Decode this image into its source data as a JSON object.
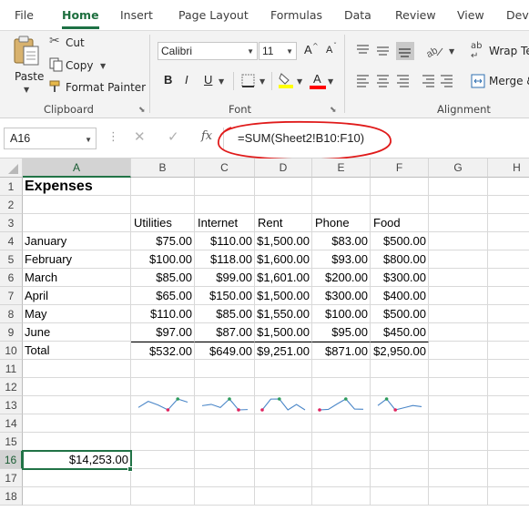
{
  "ribbon_tabs": [
    "File",
    "Home",
    "Insert",
    "Page Layout",
    "Formulas",
    "Data",
    "Review",
    "View",
    "Dev"
  ],
  "active_tab": "Home",
  "clipboard": {
    "paste": "Paste",
    "cut": "Cut",
    "copy": "Copy",
    "format_painter": "Format Painter",
    "group": "Clipboard"
  },
  "font": {
    "name": "Calibri",
    "size": "11",
    "grow": "A",
    "shrink": "A",
    "bold": "B",
    "italic": "I",
    "underline": "U",
    "font_color": "A",
    "highlight_color": "#ffff00",
    "text_color": "#ff0000",
    "group": "Font"
  },
  "alignment": {
    "wrap_text": "Wrap Te",
    "merge": "Merge &",
    "group": "Alignment"
  },
  "formula_bar": {
    "name_box": "A16",
    "fx": "fx",
    "formula": "=SUM(Sheet2!B10:F10)"
  },
  "columns": [
    "A",
    "B",
    "C",
    "D",
    "E",
    "F",
    "G",
    "H"
  ],
  "rows": [
    "1",
    "2",
    "3",
    "4",
    "5",
    "6",
    "7",
    "8",
    "9",
    "10",
    "11",
    "12",
    "13",
    "14",
    "15",
    "16",
    "17",
    "18"
  ],
  "selected_cell": "A16",
  "sheet": {
    "title": "Expenses",
    "headers": [
      "Utilities",
      "Internet",
      "Rent",
      "Phone",
      "Food"
    ],
    "data_rows": [
      {
        "month": "January",
        "values": [
          "$75.00",
          "$110.00",
          "$1,500.00",
          "$83.00",
          "$500.00"
        ]
      },
      {
        "month": "February",
        "values": [
          "$100.00",
          "$118.00",
          "$1,600.00",
          "$93.00",
          "$800.00"
        ]
      },
      {
        "month": "March",
        "values": [
          "$85.00",
          "$99.00",
          "$1,601.00",
          "$200.00",
          "$300.00"
        ]
      },
      {
        "month": "April",
        "values": [
          "$65.00",
          "$150.00",
          "$1,500.00",
          "$300.00",
          "$400.00"
        ]
      },
      {
        "month": "May",
        "values": [
          "$110.00",
          "$85.00",
          "$1,550.00",
          "$100.00",
          "$500.00"
        ]
      },
      {
        "month": "June",
        "values": [
          "$97.00",
          "$87.00",
          "$1,500.00",
          "$95.00",
          "$450.00"
        ]
      }
    ],
    "total_label": "Total",
    "totals": [
      "$532.00",
      "$649.00",
      "$9,251.00",
      "$871.00",
      "$2,950.00"
    ],
    "grand_total": "$14,253.00"
  },
  "sparklines": {
    "line_color": "#4a86c8",
    "high_color": "#2e9c5c",
    "low_color": "#e0245e",
    "series": [
      [
        75,
        100,
        85,
        65,
        110,
        97
      ],
      [
        110,
        118,
        99,
        150,
        85,
        87
      ],
      [
        1500,
        1600,
        1601,
        1500,
        1550,
        1500
      ],
      [
        83,
        93,
        200,
        300,
        100,
        95
      ],
      [
        500,
        800,
        300,
        400,
        500,
        450
      ]
    ]
  },
  "annotation_color": "#e01b1b"
}
